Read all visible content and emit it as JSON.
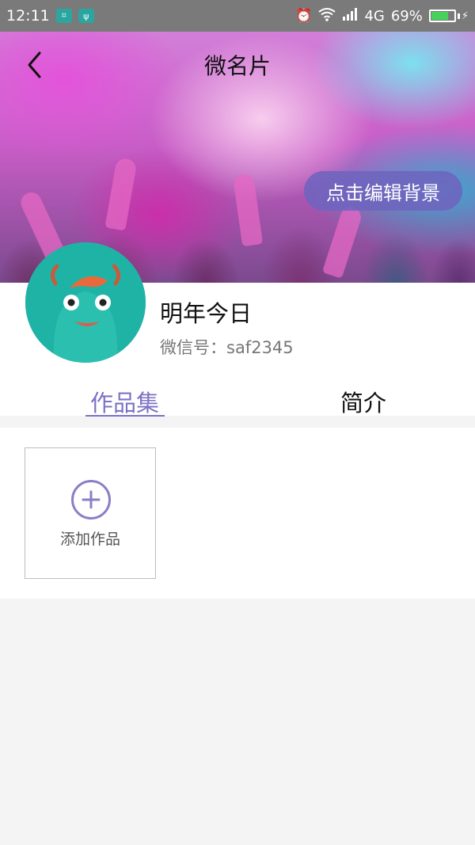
{
  "status_bar": {
    "time": "12:11",
    "network": "4G",
    "battery_percent": "69%",
    "battery_level": 0.69,
    "icons": [
      "screenshot-icon",
      "usb-icon",
      "alarm-icon",
      "wifi-icon",
      "signal-icon",
      "battery-icon"
    ]
  },
  "header": {
    "title": "微名片",
    "edit_background_label": "点击编辑背景"
  },
  "profile": {
    "name": "明年今日",
    "wechat_id": "微信号：saf2345"
  },
  "tabs": [
    {
      "label": "作品集",
      "active": true
    },
    {
      "label": "简介",
      "active": false
    }
  ],
  "works": {
    "add_label": "添加作品"
  },
  "colors": {
    "accent": "#7c72c4",
    "avatar_bg": "#1fb3a6",
    "status_bar_bg": "#7a7a7a"
  }
}
